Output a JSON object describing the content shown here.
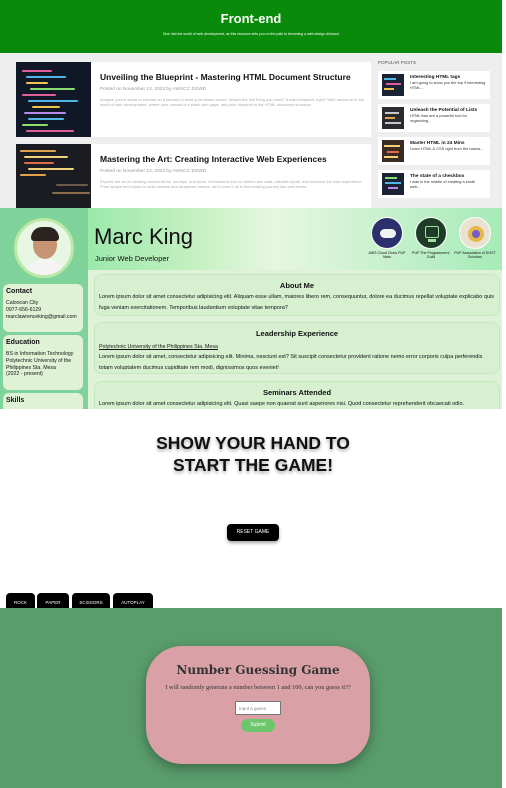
{
  "blog": {
    "header_title": "Front-end",
    "header_subtitle": "Dive into the world of web development, as this resource sets you on the path to becoming a web design virtuoso!",
    "articles": [
      {
        "title": "Unveiling the Blueprint - Mastering HTML Document Structure",
        "meta": "Posted on November 13, 2023 by AWSCC DSWD",
        "excerpt": "Imagine you're about to embark on a journey to build your dream house. What's the first thing you need? A solid blueprint, right? Well, welcome to the world of web development, where your canvas is a blank web page, and your blueprint is the HTML document structure."
      },
      {
        "title": "Mastering the Art: Creating Interactive Web Experiences",
        "meta": "Posted on November 12, 2023 by AWSCC DSWD",
        "excerpt": "Explore the art of creating contact forms, surveys, and more. Understand how to collect user data, validate inputs, and enhance the user experience. From simple text inputs to radio buttons and dropdown menus, we'll cover it all in this exciting journey into web forms."
      }
    ],
    "popular_label": "POPULAR POSTS",
    "popular_posts": [
      {
        "title": "Interesting HTML tags",
        "text": "I am going to show you the top 9 interesting HTML..."
      },
      {
        "title": "Unleash the Potential of Lists",
        "text": "HTML lists are a powerful tool for organizing..."
      },
      {
        "title": "Master HTML in 24 Mins",
        "text": "Learn HTML & CSS right from the basics..."
      },
      {
        "title": "The state of a checkbox",
        "text": "I was in the middle of creating a small web..."
      }
    ]
  },
  "resume": {
    "name": "Marc King",
    "role": "Junior Web Developer",
    "orgs": [
      {
        "label": "AWS Cloud Clubs PUP Main",
        "color": "#2b2f6b"
      },
      {
        "label": "PUP The Programmers' Guild",
        "color": "#1d3b26"
      },
      {
        "label": "PUP Association of DOST Scholars",
        "color": "#e9e2d0"
      }
    ],
    "contact": {
      "heading": "Contact",
      "city": "Caloocan City",
      "phone": "0977-656-6129",
      "email": "marclawrenceking@gmail.com"
    },
    "education": {
      "heading": "Education",
      "degree": "BS in Information Technology",
      "school": "Polytechnic University of the Philippines Sta. Mesa",
      "years": "(2022 - present)"
    },
    "skills_heading": "Skills",
    "about": {
      "heading": "About Me",
      "text": "Lorem ipsum dolor sit amet consectetur adipisicing elit. Aliquam esse ullam, maiores libero rem, consequuntur, dolore ea ducimus repellat voluptate explicabo quis fuga veniam exercitationem. Temporibus laudantium voluptate vitae tempora?"
    },
    "leadership": {
      "heading": "Leadership Experience",
      "link": "Polytechnic University of the Philippines Sta. Mesa",
      "text": "Lorem ipsum dolor sit amet, consectetur adipisicing elit. Minima, nesciunt est? Sit suscipit consectetur provident ratione nemo error corporis culpa perferendis totam voluptatem ducimus cupiditate rem modi, dignissimos quos eveniet!"
    },
    "seminars": {
      "heading": "Seminars Attended",
      "text": "Lorem ipsum dolor sit amet consectetur adipisicing elit. Quasi saepe non quaerat sunt asperiores nisi. Quod consectetur reprehenderit obcaecati odio."
    }
  },
  "rps": {
    "title_line1": "SHOW YOUR HAND TO",
    "title_line2": "START THE GAME!",
    "reset_label": "RESET GAME",
    "choices": [
      "ROCK",
      "PAPER",
      "SCISSORS",
      "AUTOPLAY"
    ]
  },
  "guess": {
    "title": "Number Guessing Game",
    "text": "I will randomly generate a number between 1 and 100, can you guess it??",
    "input_placeholder": "Input a guess",
    "submit_label": "Submit",
    "card_color": "#d9a0a6",
    "background_color": "#5a9d6c",
    "button_color": "#6cc76c"
  }
}
